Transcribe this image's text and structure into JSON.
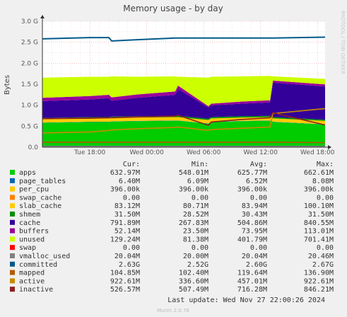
{
  "chart_data": {
    "type": "area",
    "title": "Memory usage - by day",
    "ylabel": "Bytes",
    "ylim": [
      0,
      3.0
    ],
    "y_unit": "G",
    "y_ticks": [
      "0.0",
      "0.5 G",
      "1.0 G",
      "1.5 G",
      "2.0 G",
      "2.5 G",
      "3.0 G"
    ],
    "x_ticks": [
      "Tue 18:00",
      "Wed 00:00",
      "Wed 06:00",
      "Wed 12:00",
      "Wed 18:00"
    ],
    "grid": true,
    "side_label": "RRDTOOL / TOBI OETIKER",
    "legend_headers": [
      "Cur:",
      "Min:",
      "Avg:",
      "Max:"
    ],
    "series": [
      {
        "name": "apps",
        "color": "#00cc00",
        "cur": "632.97M",
        "min": "548.01M",
        "avg": "625.77M",
        "max": "662.61M"
      },
      {
        "name": "page_tables",
        "color": "#0066b3",
        "cur": "6.40M",
        "min": "6.09M",
        "avg": "6.52M",
        "max": "8.08M"
      },
      {
        "name": "per_cpu",
        "color": "#ffcc00",
        "cur": "396.00k",
        "min": "396.00k",
        "avg": "396.00k",
        "max": "396.00k"
      },
      {
        "name": "swap_cache",
        "color": "#ff8000",
        "cur": "0.00",
        "min": "0.00",
        "avg": "0.00",
        "max": "0.00"
      },
      {
        "name": "slab_cache",
        "color": "#ffcc00",
        "cur": "83.12M",
        "min": "80.71M",
        "avg": "83.94M",
        "max": "100.10M"
      },
      {
        "name": "shmem",
        "color": "#008f00",
        "cur": "31.50M",
        "min": "28.52M",
        "avg": "30.43M",
        "max": "31.50M"
      },
      {
        "name": "cache",
        "color": "#330099",
        "cur": "791.89M",
        "min": "267.83M",
        "avg": "504.86M",
        "max": "840.55M"
      },
      {
        "name": "buffers",
        "color": "#990099",
        "cur": "52.14M",
        "min": "23.50M",
        "avg": "73.95M",
        "max": "113.01M"
      },
      {
        "name": "unused",
        "color": "#ccff00",
        "cur": "129.24M",
        "min": "81.38M",
        "avg": "401.79M",
        "max": "701.41M"
      },
      {
        "name": "swap",
        "color": "#ff0000",
        "cur": "0.00",
        "min": "0.00",
        "avg": "0.00",
        "max": "0.00"
      },
      {
        "name": "vmalloc_used",
        "color": "#808080",
        "cur": "20.04M",
        "min": "20.00M",
        "avg": "20.04M",
        "max": "20.46M"
      },
      {
        "name": "committed",
        "color": "#005a8c",
        "cur": "2.63G",
        "min": "2.52G",
        "avg": "2.60G",
        "max": "2.67G"
      },
      {
        "name": "mapped",
        "color": "#b35a00",
        "cur": "104.85M",
        "min": "102.40M",
        "avg": "119.64M",
        "max": "136.90M"
      },
      {
        "name": "active",
        "color": "#c88a00",
        "cur": "922.61M",
        "min": "336.60M",
        "avg": "457.01M",
        "max": "922.61M"
      },
      {
        "name": "inactive",
        "color": "#8c2020",
        "cur": "526.57M",
        "min": "507.49M",
        "avg": "716.28M",
        "max": "846.21M"
      }
    ],
    "stacked_order": [
      "apps",
      "page_tables",
      "per_cpu",
      "swap_cache",
      "slab_cache",
      "shmem",
      "cache",
      "buffers",
      "unused",
      "swap"
    ],
    "line_order": [
      "vmalloc_used",
      "committed",
      "mapped",
      "active",
      "inactive"
    ],
    "x_range_hours": [
      -5.0,
      24.8
    ],
    "x_tick_hours": [
      0,
      6,
      12,
      18,
      24
    ],
    "samples_hours": [
      -5.0,
      0.0,
      2.0,
      2.3,
      5.0,
      9.0,
      9.3,
      12.5,
      12.8,
      16.0,
      19.0,
      19.3,
      24.8
    ],
    "stack_values_G": {
      "apps": [
        0.58,
        0.6,
        0.6,
        0.61,
        0.62,
        0.63,
        0.63,
        0.56,
        0.6,
        0.62,
        0.63,
        0.6,
        0.54
      ],
      "page_tables": [
        0.006,
        0.006,
        0.006,
        0.006,
        0.006,
        0.006,
        0.006,
        0.006,
        0.006,
        0.006,
        0.006,
        0.006,
        0.006
      ],
      "per_cpu": [
        0.0004,
        0.0004,
        0.0004,
        0.0004,
        0.0004,
        0.0004,
        0.0004,
        0.0004,
        0.0004,
        0.0004,
        0.0004,
        0.0004,
        0.0004
      ],
      "swap_cache": [
        0,
        0,
        0,
        0,
        0,
        0,
        0,
        0,
        0,
        0,
        0,
        0,
        0
      ],
      "slab_cache": [
        0.08,
        0.08,
        0.08,
        0.08,
        0.08,
        0.08,
        0.08,
        0.08,
        0.08,
        0.08,
        0.08,
        0.08,
        0.08
      ],
      "shmem": [
        0.03,
        0.03,
        0.03,
        0.03,
        0.03,
        0.03,
        0.03,
        0.03,
        0.03,
        0.03,
        0.03,
        0.03,
        0.03
      ],
      "cache": [
        0.4,
        0.42,
        0.45,
        0.38,
        0.44,
        0.5,
        0.64,
        0.27,
        0.28,
        0.3,
        0.32,
        0.82,
        0.79
      ],
      "buffers": [
        0.08,
        0.08,
        0.08,
        0.08,
        0.08,
        0.08,
        0.08,
        0.03,
        0.04,
        0.05,
        0.05,
        0.05,
        0.05
      ],
      "unused": [
        0.48,
        0.46,
        0.43,
        0.5,
        0.42,
        0.36,
        0.21,
        0.68,
        0.64,
        0.6,
        0.58,
        0.1,
        0.13
      ],
      "swap": [
        0,
        0,
        0,
        0,
        0,
        0,
        0,
        0,
        0,
        0,
        0,
        0,
        0
      ]
    },
    "line_values_G": {
      "vmalloc_used": [
        0.02,
        0.02,
        0.02,
        0.02,
        0.02,
        0.02,
        0.02,
        0.02,
        0.02,
        0.02,
        0.02,
        0.02,
        0.02
      ],
      "committed": [
        2.58,
        2.61,
        2.61,
        2.53,
        2.56,
        2.6,
        2.6,
        2.6,
        2.6,
        2.6,
        2.6,
        2.6,
        2.62
      ],
      "mapped": [
        0.12,
        0.12,
        0.12,
        0.12,
        0.12,
        0.12,
        0.12,
        0.12,
        0.12,
        0.12,
        0.12,
        0.12,
        0.11
      ],
      "active": [
        0.34,
        0.36,
        0.4,
        0.41,
        0.44,
        0.47,
        0.48,
        0.4,
        0.42,
        0.45,
        0.48,
        0.8,
        0.92
      ],
      "inactive": [
        0.68,
        0.69,
        0.7,
        0.7,
        0.72,
        0.74,
        0.76,
        0.52,
        0.6,
        0.66,
        0.7,
        0.82,
        0.53
      ]
    }
  },
  "footer": {
    "last_update": "Last update: Wed Nov 27 22:00:26 2024",
    "munin_version": "Munin 2.0.76"
  }
}
